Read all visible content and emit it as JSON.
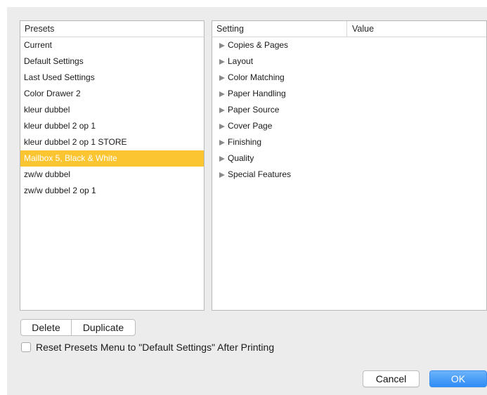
{
  "presets": {
    "header": "Presets",
    "items": [
      "Current",
      "Default Settings",
      "Last Used Settings",
      "Color Drawer 2",
      "kleur dubbel",
      "kleur dubbel 2 op 1",
      "kleur dubbel 2 op 1 STORE",
      "Mailbox 5, Black & White",
      "zw/w dubbel",
      "zw/w dubbel 2 op 1"
    ],
    "selected_index": 7
  },
  "settings": {
    "headers": {
      "setting": "Setting",
      "value": "Value"
    },
    "rows": [
      "Copies & Pages",
      "Layout",
      "Color Matching",
      "Paper Handling",
      "Paper Source",
      "Cover Page",
      "Finishing",
      "Quality",
      "Special Features"
    ]
  },
  "actions": {
    "delete_label": "Delete",
    "duplicate_label": "Duplicate"
  },
  "reset_checkbox": {
    "label": "Reset Presets Menu to \"Default Settings\" After Printing",
    "checked": false
  },
  "footer": {
    "cancel_label": "Cancel",
    "ok_label": "OK"
  },
  "colors": {
    "selection": "#fbc531",
    "default_button": "#2f8cf6"
  }
}
